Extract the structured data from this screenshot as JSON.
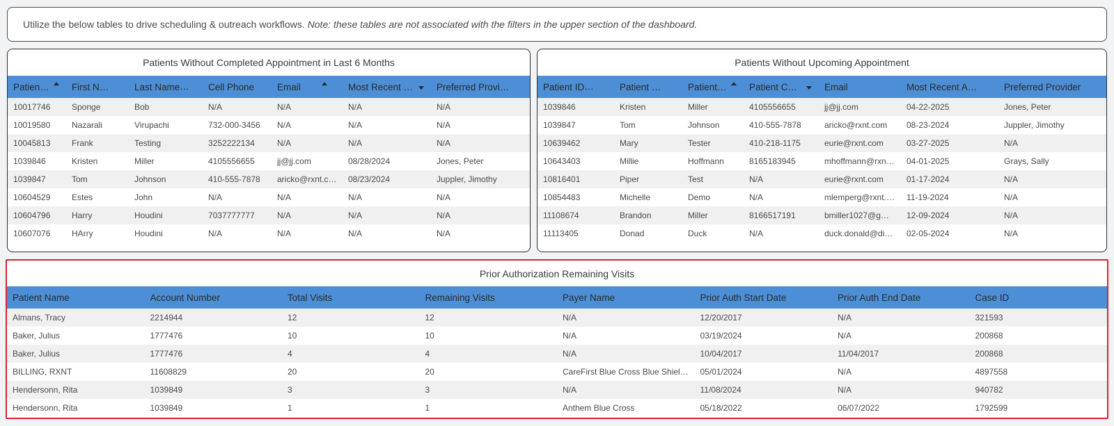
{
  "note": {
    "text": "Utilize the below tables to drive scheduling & outreach workflows.",
    "italic": "Note: these tables are not associated with the filters in the upper section of the dashboard."
  },
  "left_table": {
    "title": "Patients Without Completed Appointment in Last 6 Months",
    "columns": [
      "Patient ID",
      "First Name",
      "Last Name",
      "Cell Phone",
      "Email",
      "Most Recent Co...",
      "Preferred Provider"
    ],
    "rows": [
      [
        "10017746",
        "Sponge",
        "Bob",
        "N/A",
        "N/A",
        "N/A",
        "N/A"
      ],
      [
        "10019580",
        "Nazarali",
        "Virupachi",
        "732-000-3456",
        "N/A",
        "N/A",
        "N/A"
      ],
      [
        "10045813",
        "Frank",
        "Testing",
        "3252222134",
        "N/A",
        "N/A",
        "N/A"
      ],
      [
        "1039846",
        "Kristen",
        "Miller",
        "4105556655",
        "jj@jj.com",
        "08/28/2024",
        "Jones, Peter"
      ],
      [
        "1039847",
        "Tom",
        "Johnson",
        "410-555-7878",
        "aricko@rxnt.com",
        "08/23/2024",
        "Juppler, Jimothy"
      ],
      [
        "10604529",
        "Estes",
        "John",
        "N/A",
        "N/A",
        "N/A",
        "N/A"
      ],
      [
        "10604796",
        "Harry",
        "Houdini",
        "7037777777",
        "N/A",
        "N/A",
        "N/A"
      ],
      [
        "10607076",
        "HArry",
        "Houdini",
        "N/A",
        "N/A",
        "N/A",
        "N/A"
      ]
    ]
  },
  "right_table": {
    "title": "Patients Without Upcoming Appointment",
    "columns": [
      "Patient ID",
      "Patient Firs...",
      "Patient L...",
      "Patient Cell ...",
      "Email",
      "Most Recent Appoi...",
      "Preferred Provider"
    ],
    "rows": [
      [
        "1039846",
        "Kristen",
        "Miller",
        "4105556655",
        "jj@jj.com",
        "04-22-2025",
        "Jones, Peter"
      ],
      [
        "1039847",
        "Tom",
        "Johnson",
        "410-555-7878",
        "aricko@rxnt.com",
        "08-23-2024",
        "Juppler, Jimothy"
      ],
      [
        "10639462",
        "Mary",
        "Tester",
        "410-218-1175",
        "eurie@rxnt.com",
        "03-27-2025",
        "N/A"
      ],
      [
        "10643403",
        "Millie",
        "Hoffmann",
        "8165183945",
        "mhoffmann@rxnt....",
        "04-01-2025",
        "Grays, Sally"
      ],
      [
        "10816401",
        "Piper",
        "Test",
        "N/A",
        "eurie@rxnt.com",
        "01-17-2024",
        "N/A"
      ],
      [
        "10854483",
        "Michelle",
        "Demo",
        "N/A",
        "mlemperg@rxnt.c...",
        "11-19-2024",
        "N/A"
      ],
      [
        "11108674",
        "Brandon",
        "Miller",
        "8166517191",
        "bmiller1027@gma...",
        "12-09-2024",
        "N/A"
      ],
      [
        "11113405",
        "Donad",
        "Duck",
        "N/A",
        "duck.donald@disn...",
        "02-05-2024",
        "N/A"
      ]
    ]
  },
  "bottom_table": {
    "title": "Prior Authorization Remaining Visits",
    "columns": [
      "Patient Name",
      "Account Number",
      "Total Visits",
      "Remaining Visits",
      "Payer Name",
      "Prior Auth Start Date",
      "Prior Auth End Date",
      "Case ID"
    ],
    "rows": [
      [
        "Almans, Tracy",
        "2214944",
        "12",
        "12",
        "N/A",
        "12/20/2017",
        "N/A",
        "321593"
      ],
      [
        "Baker, Julius",
        "1777476",
        "10",
        "10",
        "N/A",
        "03/19/2024",
        "N/A",
        "200868"
      ],
      [
        "Baker, Julius",
        "1777476",
        "4",
        "4",
        "N/A",
        "10/04/2017",
        "11/04/2017",
        "200868"
      ],
      [
        "BILLING, RXNT",
        "11608829",
        "20",
        "20",
        "CareFirst Blue Cross Blue Shield ...",
        "05/01/2024",
        "N/A",
        "4897558"
      ],
      [
        "Hendersonn, Rita",
        "1039849",
        "3",
        "3",
        "N/A",
        "11/08/2024",
        "N/A",
        "940782"
      ],
      [
        "Hendersonn, Rita",
        "1039849",
        "1",
        "1",
        "Anthem Blue Cross",
        "05/18/2022",
        "06/07/2022",
        "1792599"
      ]
    ]
  },
  "icons": {
    "sort_asc": "sort-ascending-icon",
    "sort_desc": "sort-descending-icon"
  },
  "colors": {
    "header": "#4d8fd6",
    "highlight_border": "#d9232e"
  }
}
